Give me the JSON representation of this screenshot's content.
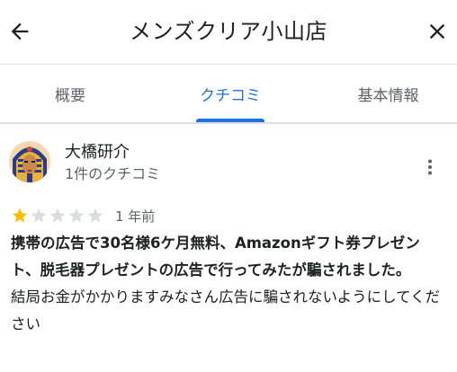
{
  "header": {
    "title": "メンズクリア小山店",
    "back_icon": "arrow-back-icon",
    "close_icon": "close-icon"
  },
  "tabs": [
    {
      "label": "概要",
      "active": false
    },
    {
      "label": "クチコミ",
      "active": true
    },
    {
      "label": "基本情報",
      "active": false
    }
  ],
  "review": {
    "reviewer_name": "大橋研介",
    "reviewer_review_count": "1件のクチコミ",
    "rating": 1,
    "max_rating": 5,
    "date": "1 年前",
    "text_bold": "携帯の広告で30名様6ケ月無料、Amazonギフト券プレゼント、脱毛器プレゼントの広告で行ってみたが騙されました。",
    "text_normal": "結局お金がかかりますみなさん広告に騙されないようにしてください",
    "more_icon": "more-vert-icon"
  },
  "colors": {
    "accent": "#1a73e8",
    "star_filled": "#fbbc04",
    "star_empty": "#dadce0",
    "text_primary": "#202124",
    "text_secondary": "#5f6368"
  }
}
